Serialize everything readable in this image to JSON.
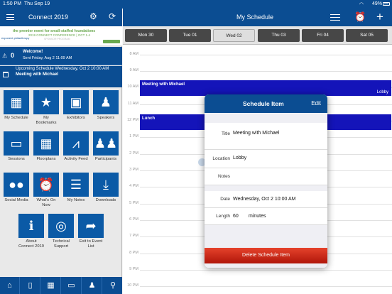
{
  "status_bar": {
    "time": "1:50 PM",
    "date": "Thu Sep 19",
    "battery": "49%"
  },
  "left": {
    "app_title": "Connect 2019",
    "banner": {
      "line1": "the premier event for small-staffed foundations",
      "line2": "2019 CONNECT CONFERENCE | OCT 1-4",
      "line3": "SPONSOR PROGRAM",
      "logo": "exponent philanthropy"
    },
    "welcome": {
      "count": "0",
      "title": "Welcome!",
      "sent": "Sent Friday, Aug 2 11:09 AM"
    },
    "upcoming": {
      "line1": "Upcoming Schedule Wednesday, Oct 2 10:00 AM",
      "line2": "Meeting with Michael"
    },
    "tiles": [
      {
        "label": "My Schedule",
        "icon": "calendar-icon"
      },
      {
        "label": "My Bookmarks",
        "icon": "star-icon"
      },
      {
        "label": "Exhibitors",
        "icon": "exhibitor-icon"
      },
      {
        "label": "Speakers",
        "icon": "speaker-icon"
      },
      {
        "label": "Sessions",
        "icon": "presentation-icon"
      },
      {
        "label": "Floorplans",
        "icon": "floorplan-icon"
      },
      {
        "label": "Activity Feed",
        "icon": "activity-icon"
      },
      {
        "label": "Participants",
        "icon": "people-icon"
      },
      {
        "label": "Social Media",
        "icon": "chat-icon"
      },
      {
        "label": "What's On Now",
        "icon": "alarm-clock-icon"
      },
      {
        "label": "My Notes",
        "icon": "notes-icon"
      },
      {
        "label": "Downloads",
        "icon": "download-icon"
      },
      {
        "label": "About Connect 2019",
        "icon": "info-icon"
      },
      {
        "label": "Technical Support",
        "icon": "lifebuoy-icon"
      },
      {
        "label": "Exit to Event List",
        "icon": "exit-arrow-icon"
      }
    ]
  },
  "right": {
    "title": "My Schedule",
    "days": [
      "Mon 30",
      "Tue 01",
      "Wed 02",
      "Thu 03",
      "Fri 04",
      "Sat 05"
    ],
    "selected_day": "Wed 02",
    "hours": [
      "8 AM",
      "9 AM",
      "10 AM",
      "11 AM",
      "12 PM",
      "1 PM",
      "2 PM",
      "3 PM",
      "4 PM",
      "5 PM",
      "6 PM",
      "7 PM",
      "8 PM",
      "9 PM",
      "10 PM"
    ],
    "events": [
      {
        "title": "Meeting with Michael",
        "location": "Lobby"
      },
      {
        "title": "Lunch",
        "location": ""
      }
    ]
  },
  "popover": {
    "header": "Schedule Item",
    "edit_label": "Edit",
    "title_label": "Title",
    "title_value": "Meeting with Michael",
    "location_label": "Location",
    "location_value": "Lobby",
    "notes_label": "Notes",
    "date_label": "Date",
    "date_value": "Wednesday, Oct 2 10:00 AM",
    "length_label": "Length",
    "length_value": "60",
    "length_unit": "minutes",
    "delete_label": "Delete Schedule Item"
  },
  "colors": {
    "brand": "#0b4d92",
    "event": "#1414b9",
    "delete": "#d32a18"
  }
}
